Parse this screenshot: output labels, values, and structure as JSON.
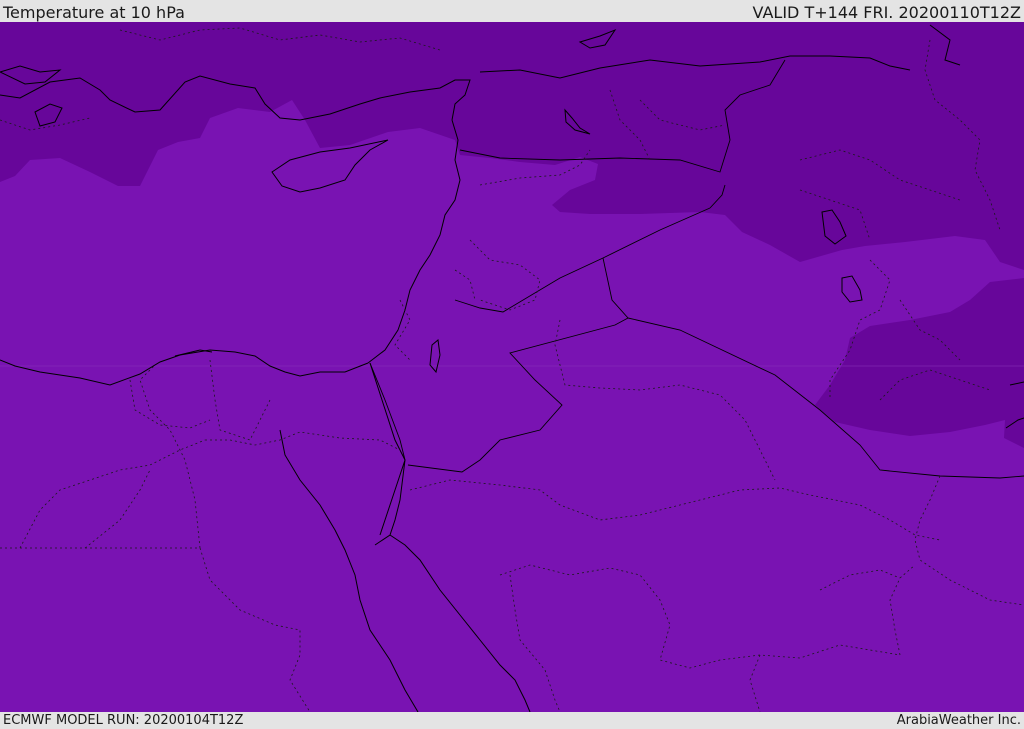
{
  "header": {
    "title": "Temperature at 10 hPa",
    "valid": "VALID T+144 FRI. 20200110T12Z"
  },
  "footer": {
    "model_run": "ECMWF MODEL RUN: 20200104T12Z",
    "credit": "ArabiaWeather Inc."
  },
  "map": {
    "variable": "temperature",
    "level": "10 hPa",
    "colors": {
      "base_field": "#7913b2",
      "cold_field": "#67069a",
      "coastline": "#000000",
      "borders": "#1a1a1a"
    }
  }
}
